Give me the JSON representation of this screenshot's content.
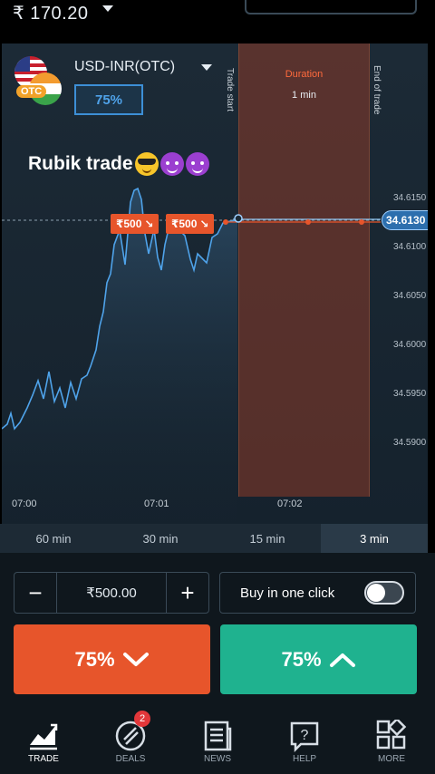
{
  "topbar": {
    "balance": "₹ 170.20"
  },
  "asset": {
    "pair": "USD-INR(OTC)",
    "payout": "75%",
    "otc_badge": "OTC",
    "flag_icons": [
      "us-flag-icon",
      "india-flag-icon"
    ]
  },
  "overlay_text": "Rubik trade",
  "chart": {
    "duration_label": "Duration",
    "duration_value": "1 min",
    "trade_start_label": "Trade start",
    "end_label": "End of trade",
    "current_price": "34.6130",
    "price_ticks": [
      "34.6150",
      "34.6100",
      "34.6050",
      "34.6000",
      "34.5950",
      "34.5900"
    ],
    "time_ticks": [
      "07:00",
      "07:01",
      "07:02"
    ],
    "trades": [
      {
        "label": "₹500",
        "direction": "down"
      },
      {
        "label": "₹500",
        "direction": "down"
      }
    ],
    "colors": {
      "line": "#4fa3ea",
      "trade": "#e7552b",
      "zone": "#8c3a28"
    }
  },
  "timeframes": [
    {
      "label": "60 min",
      "active": false
    },
    {
      "label": "30 min",
      "active": false
    },
    {
      "label": "15 min",
      "active": false
    },
    {
      "label": "3 min",
      "active": true
    }
  ],
  "trade_panel": {
    "minus": "−",
    "plus": "+",
    "amount": "₹500.00",
    "one_click_label": "Buy in one click",
    "one_click_on": false,
    "down_button": {
      "label": "75%",
      "color": "#e7552b"
    },
    "up_button": {
      "label": "75%",
      "color": "#1fb28f"
    }
  },
  "nav": [
    {
      "label": "TRADE",
      "icon": "chart-trend-icon",
      "active": true
    },
    {
      "label": "DEALS",
      "icon": "deals-icon",
      "badge": "2"
    },
    {
      "label": "NEWS",
      "icon": "news-icon"
    },
    {
      "label": "HELP",
      "icon": "help-icon"
    },
    {
      "label": "MORE",
      "icon": "more-grid-icon"
    }
  ]
}
